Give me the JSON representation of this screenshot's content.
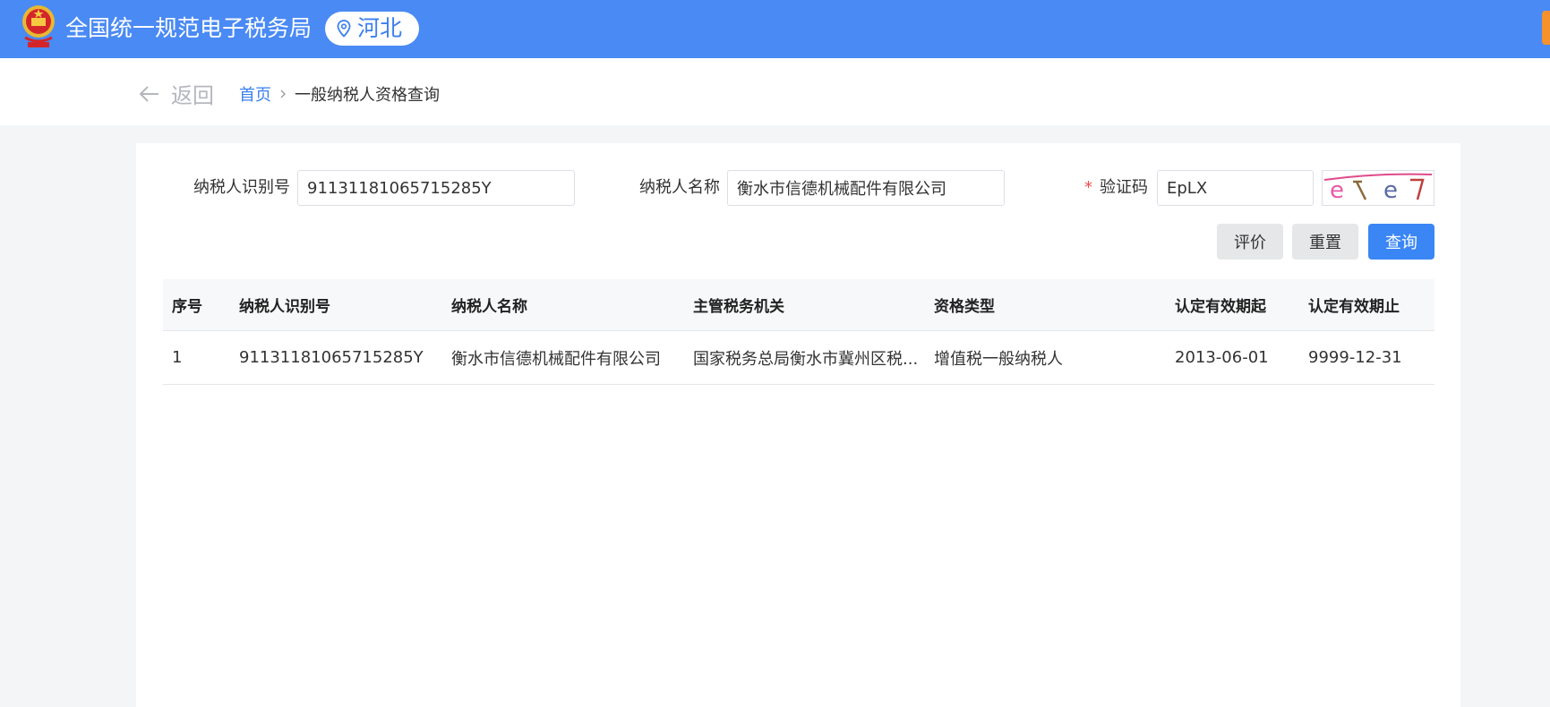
{
  "header": {
    "site_title": "全国统一规范电子税务局",
    "region": "河北",
    "colors": {
      "topbar": "#4a8af4",
      "accent": "#3b7ff0",
      "orange_tab": "#f5922c"
    }
  },
  "nav": {
    "back_label": "返回",
    "breadcrumb": {
      "home": "首页",
      "current": "一般纳税人资格查询"
    }
  },
  "form": {
    "taxpayer_id": {
      "label": "纳税人识别号",
      "value": "91131181065715285Y"
    },
    "taxpayer_name": {
      "label": "纳税人名称",
      "value": "衡水市信德机械配件有限公司"
    },
    "captcha": {
      "required_mark": "*",
      "label": "验证码",
      "value": "EpLX",
      "image_text": "eTeT"
    },
    "buttons": {
      "evaluate": "评价",
      "reset": "重置",
      "query": "查询"
    }
  },
  "table": {
    "columns": [
      "序号",
      "纳税人识别号",
      "纳税人名称",
      "主管税务机关",
      "资格类型",
      "认定有效期起",
      "认定有效期止"
    ],
    "rows": [
      [
        "1",
        "91131181065715285Y",
        "衡水市信德机械配件有限公司",
        "国家税务总局衡水市冀州区税...",
        "增值税一般纳税人",
        "2013-06-01",
        "9999-12-31"
      ]
    ]
  }
}
